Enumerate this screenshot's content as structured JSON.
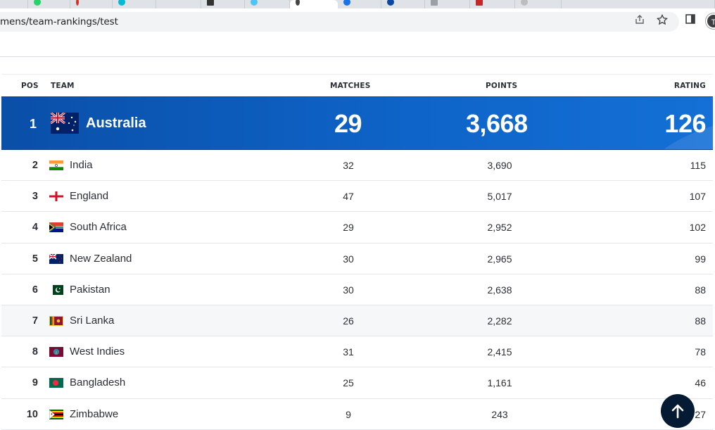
{
  "browser": {
    "url": "mens/team-rankings/test",
    "avatar_letter": "T"
  },
  "table": {
    "headers": {
      "pos": "POS",
      "team": "TEAM",
      "matches": "MATCHES",
      "points": "POINTS",
      "rating": "RATING"
    },
    "leader": {
      "pos": "1",
      "team": "Australia",
      "matches": "29",
      "points": "3,668",
      "rating": "126"
    },
    "rows": [
      {
        "pos": "2",
        "team": "India",
        "matches": "32",
        "points": "3,690",
        "rating": "115",
        "flag": "india"
      },
      {
        "pos": "3",
        "team": "England",
        "matches": "47",
        "points": "5,017",
        "rating": "107",
        "flag": "england"
      },
      {
        "pos": "4",
        "team": "South Africa",
        "matches": "29",
        "points": "2,952",
        "rating": "102",
        "flag": "south-africa"
      },
      {
        "pos": "5",
        "team": "New Zealand",
        "matches": "30",
        "points": "2,965",
        "rating": "99",
        "flag": "new-zealand"
      },
      {
        "pos": "6",
        "team": "Pakistan",
        "matches": "30",
        "points": "2,638",
        "rating": "88",
        "flag": "pakistan"
      },
      {
        "pos": "7",
        "team": "Sri Lanka",
        "matches": "26",
        "points": "2,282",
        "rating": "88",
        "flag": "sri-lanka"
      },
      {
        "pos": "8",
        "team": "West Indies",
        "matches": "31",
        "points": "2,415",
        "rating": "78",
        "flag": "west-indies"
      },
      {
        "pos": "9",
        "team": "Bangladesh",
        "matches": "25",
        "points": "1,161",
        "rating": "46",
        "flag": "bangladesh"
      },
      {
        "pos": "10",
        "team": "Zimbabwe",
        "matches": "9",
        "points": "243",
        "rating": "27",
        "flag": "zimbabwe"
      }
    ]
  },
  "colors": {
    "leader_bg": "#0e63c7",
    "scroll_button": "#051a33"
  }
}
